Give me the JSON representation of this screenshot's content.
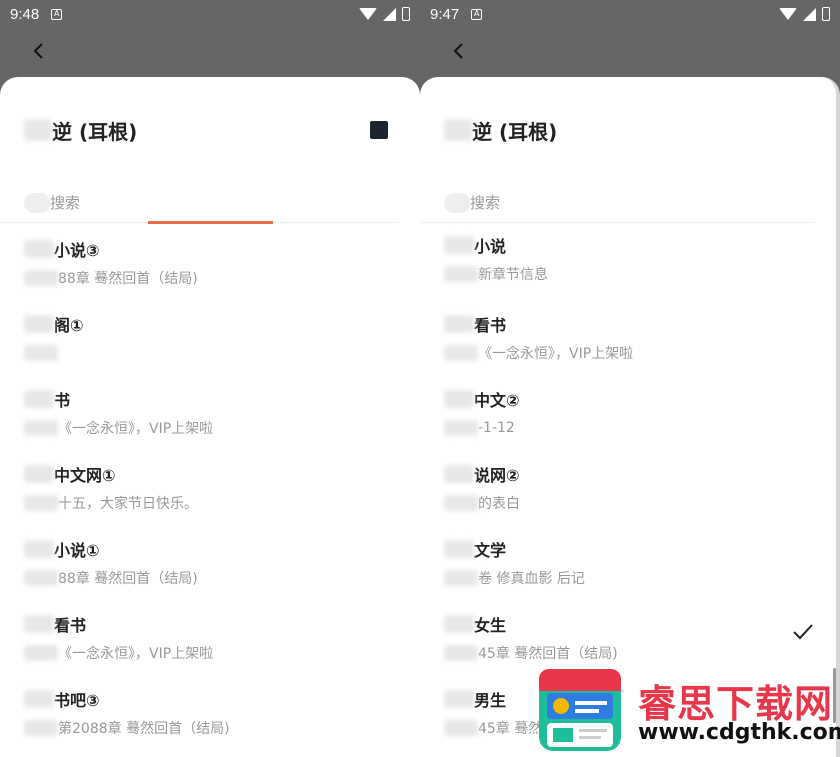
{
  "left": {
    "status": {
      "time": "9:48",
      "notif": "A"
    },
    "title": "逆 (耳根)",
    "search_placeholder": "搜索",
    "items": [
      {
        "name": "小说③",
        "sub": "88章 蓦然回首（结局)"
      },
      {
        "name": "阁①",
        "sub": ""
      },
      {
        "name": "书",
        "sub": "《一念永恒》，VIP上架啦"
      },
      {
        "name": "中文网①",
        "sub": "十五，大家节日快乐。"
      },
      {
        "name": "小说①",
        "sub": "88章 蓦然回首（结局)"
      },
      {
        "name": "看书",
        "sub": "《一念永恒》，VIP上架啦"
      },
      {
        "name": "书吧③",
        "sub": "第2088章 蓦然回首（结局)"
      }
    ]
  },
  "right": {
    "status": {
      "time": "9:47",
      "notif": "A"
    },
    "title": "逆 (耳根)",
    "search_placeholder": "搜索",
    "items": [
      {
        "name": "小说",
        "sub": "新章节信息",
        "checked": false
      },
      {
        "name": "看书",
        "sub": "《一念永恒》，VIP上架啦",
        "checked": false
      },
      {
        "name": "中文②",
        "sub": "-1-12",
        "checked": false
      },
      {
        "name": "说网②",
        "sub": "的表白",
        "checked": false
      },
      {
        "name": "文学",
        "sub": "卷 修真血影 后记",
        "checked": false
      },
      {
        "name": "女生",
        "sub": "45章 蓦然回首（结局)",
        "checked": true
      },
      {
        "name": "男生",
        "sub": "45章 蓦然",
        "checked": false
      }
    ]
  },
  "icons": {
    "back": "back-arrow-icon",
    "stop": "stop-square-icon",
    "check": "checkmark-icon"
  },
  "watermark": {
    "title": "睿思下载网",
    "url": "www.cdgthk.com"
  },
  "colors": {
    "header": "#666666",
    "progress": "#e56f46",
    "stop": "#1a2530",
    "watermark_red": "#e8364b"
  }
}
